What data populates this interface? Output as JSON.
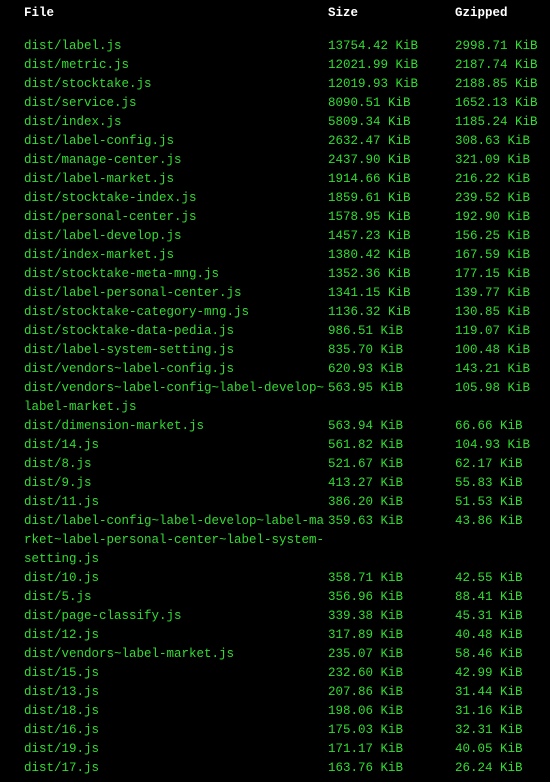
{
  "headers": {
    "file": "File",
    "size": "Size",
    "gzipped": "Gzipped"
  },
  "chart_data": {
    "type": "table",
    "columns": [
      "File",
      "Size",
      "Gzipped"
    ],
    "rows": [
      {
        "file": "dist/label.js",
        "size": "13754.42 KiB",
        "gzipped": "2998.71 KiB"
      },
      {
        "file": "dist/metric.js",
        "size": "12021.99 KiB",
        "gzipped": "2187.74 KiB"
      },
      {
        "file": "dist/stocktake.js",
        "size": "12019.93 KiB",
        "gzipped": "2188.85 KiB"
      },
      {
        "file": "dist/service.js",
        "size": "8090.51 KiB",
        "gzipped": "1652.13 KiB"
      },
      {
        "file": "dist/index.js",
        "size": "5809.34 KiB",
        "gzipped": "1185.24 KiB"
      },
      {
        "file": "dist/label-config.js",
        "size": "2632.47 KiB",
        "gzipped": "308.63 KiB"
      },
      {
        "file": "dist/manage-center.js",
        "size": "2437.90 KiB",
        "gzipped": "321.09 KiB"
      },
      {
        "file": "dist/label-market.js",
        "size": "1914.66 KiB",
        "gzipped": "216.22 KiB"
      },
      {
        "file": "dist/stocktake-index.js",
        "size": "1859.61 KiB",
        "gzipped": "239.52 KiB"
      },
      {
        "file": "dist/personal-center.js",
        "size": "1578.95 KiB",
        "gzipped": "192.90 KiB"
      },
      {
        "file": "dist/label-develop.js",
        "size": "1457.23 KiB",
        "gzipped": "156.25 KiB"
      },
      {
        "file": "dist/index-market.js",
        "size": "1380.42 KiB",
        "gzipped": "167.59 KiB"
      },
      {
        "file": "dist/stocktake-meta-mng.js",
        "size": "1352.36 KiB",
        "gzipped": "177.15 KiB"
      },
      {
        "file": "dist/label-personal-center.js",
        "size": "1341.15 KiB",
        "gzipped": "139.77 KiB"
      },
      {
        "file": "dist/stocktake-category-mng.js",
        "size": "1136.32 KiB",
        "gzipped": "130.85 KiB"
      },
      {
        "file": "dist/stocktake-data-pedia.js",
        "size": "986.51 KiB",
        "gzipped": "119.07 KiB"
      },
      {
        "file": "dist/label-system-setting.js",
        "size": "835.70 KiB",
        "gzipped": "100.48 KiB"
      },
      {
        "file": "dist/vendors~label-config.js",
        "size": "620.93 KiB",
        "gzipped": "143.21 KiB"
      },
      {
        "file": "dist/vendors~label-config~label-develop~label-market.js",
        "size": "563.95 KiB",
        "gzipped": "105.98 KiB"
      },
      {
        "file": "dist/dimension-market.js",
        "size": "563.94 KiB",
        "gzipped": "66.66 KiB"
      },
      {
        "file": "dist/14.js",
        "size": "561.82 KiB",
        "gzipped": "104.93 KiB"
      },
      {
        "file": "dist/8.js",
        "size": "521.67 KiB",
        "gzipped": "62.17 KiB"
      },
      {
        "file": "dist/9.js",
        "size": "413.27 KiB",
        "gzipped": "55.83 KiB"
      },
      {
        "file": "dist/11.js",
        "size": "386.20 KiB",
        "gzipped": "51.53 KiB"
      },
      {
        "file": "dist/label-config~label-develop~label-market~label-personal-center~label-system-setting.js",
        "size": "359.63 KiB",
        "gzipped": "43.86 KiB"
      },
      {
        "file": "dist/10.js",
        "size": "358.71 KiB",
        "gzipped": "42.55 KiB"
      },
      {
        "file": "dist/5.js",
        "size": "356.96 KiB",
        "gzipped": "88.41 KiB"
      },
      {
        "file": "dist/page-classify.js",
        "size": "339.38 KiB",
        "gzipped": "45.31 KiB"
      },
      {
        "file": "dist/12.js",
        "size": "317.89 KiB",
        "gzipped": "40.48 KiB"
      },
      {
        "file": "dist/vendors~label-market.js",
        "size": "235.07 KiB",
        "gzipped": "58.46 KiB"
      },
      {
        "file": "dist/15.js",
        "size": "232.60 KiB",
        "gzipped": "42.99 KiB"
      },
      {
        "file": "dist/13.js",
        "size": "207.86 KiB",
        "gzipped": "31.44 KiB"
      },
      {
        "file": "dist/18.js",
        "size": "198.06 KiB",
        "gzipped": "31.16 KiB"
      },
      {
        "file": "dist/16.js",
        "size": "175.03 KiB",
        "gzipped": "32.31 KiB"
      },
      {
        "file": "dist/19.js",
        "size": "171.17 KiB",
        "gzipped": "40.05 KiB"
      },
      {
        "file": "dist/17.js",
        "size": "163.76 KiB",
        "gzipped": "26.24 KiB"
      }
    ]
  }
}
